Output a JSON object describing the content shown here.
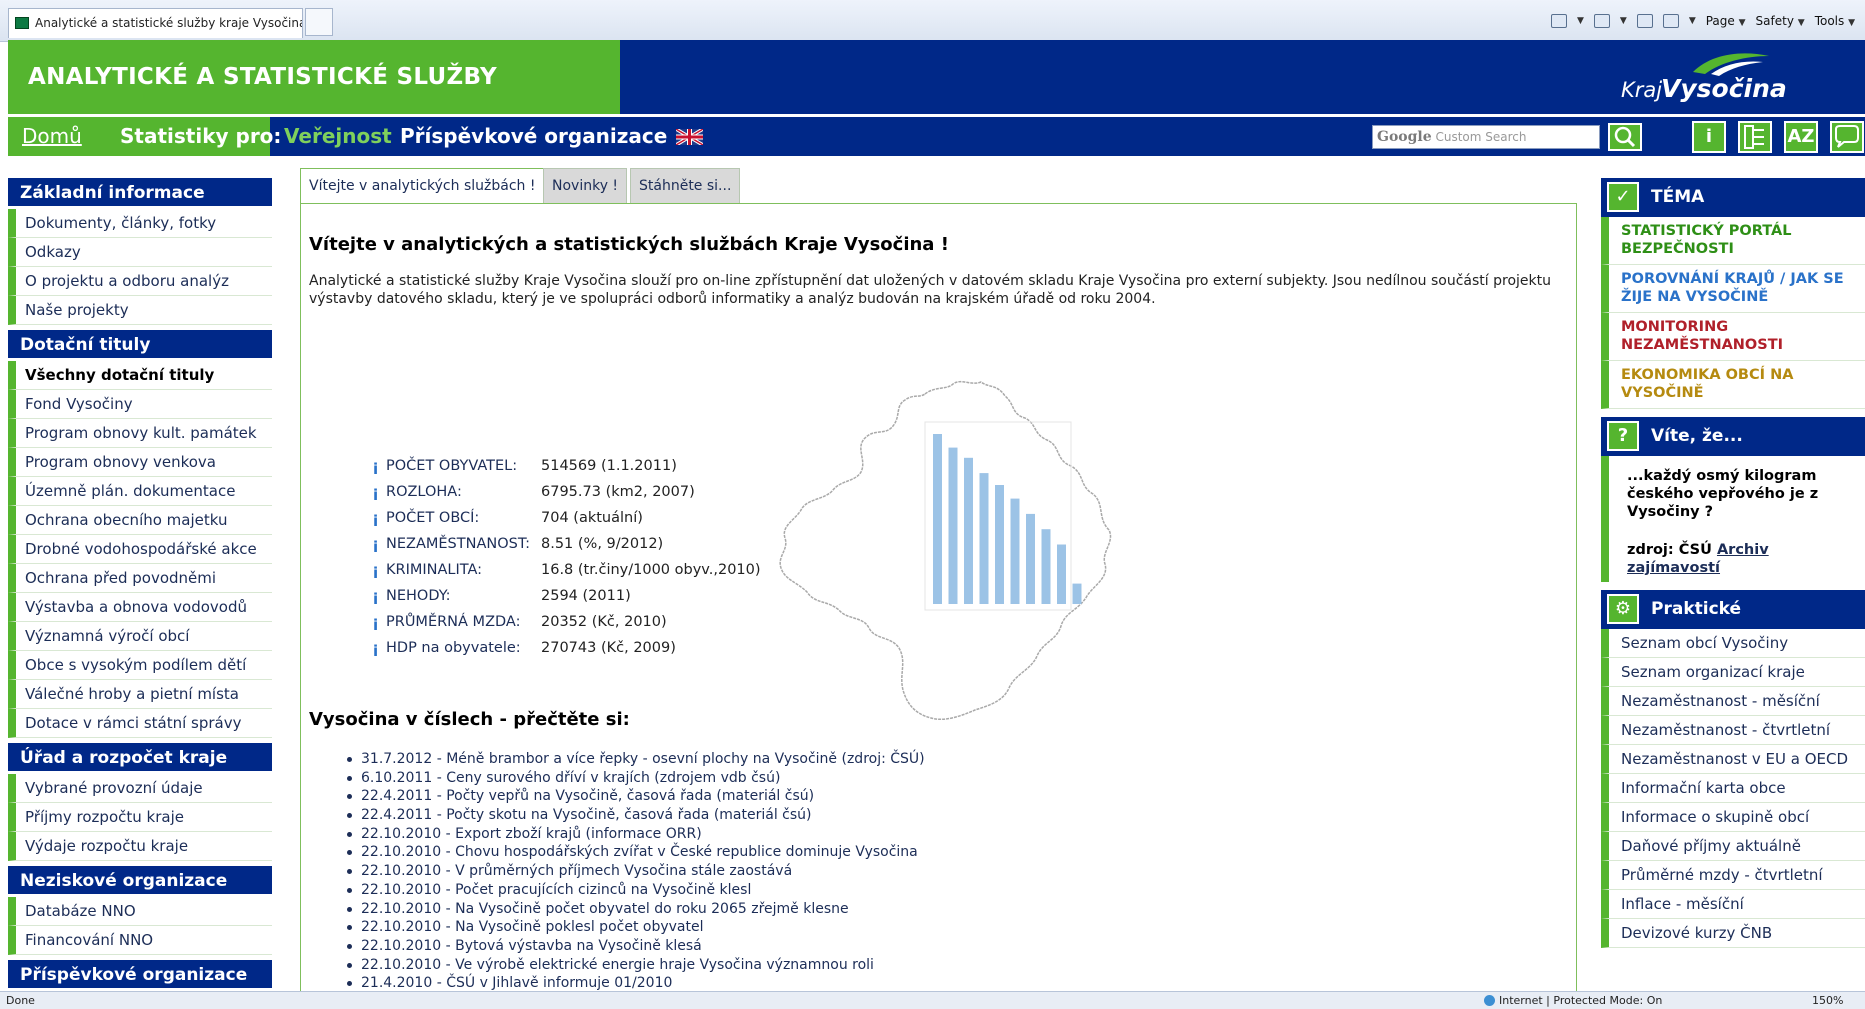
{
  "browser": {
    "tab_title": "Analytické a statistické služby kraje Vysočina",
    "commands": [
      "Page",
      "Safety",
      "Tools"
    ],
    "status_left": "Done",
    "status_zone": "Internet | Protected Mode: On",
    "status_zoom": "150%"
  },
  "header": {
    "site_title": "ANALYTICKÉ A STATISTICKÉ SLUŽBY",
    "logo_kraj": "Kraj",
    "logo_vysocina": "Vysočina",
    "brand_green": "#55b52f",
    "brand_blue": "#002888"
  },
  "nav": {
    "home": "Domů",
    "stats_for": "Statistiky pro:",
    "public": "Veřejnost",
    "contrib": "Příspěvkové organizace",
    "search_brand": "Google",
    "search_placeholder": "Custom Search",
    "tool_icons": [
      "info-icon",
      "sitemap-icon",
      "az-index-icon",
      "chat-icon"
    ],
    "tool_labels": {
      "info": "i",
      "az": "AZ"
    }
  },
  "left_sidebar": {
    "sections": [
      {
        "title": "Základní informace",
        "items": [
          "Dokumenty, články, fotky",
          "Odkazy",
          "O projektu a odboru analýz",
          "Naše projekty"
        ]
      },
      {
        "title": "Dotační tituly",
        "items": [
          "Všechny dotační tituly",
          "Fond Vysočiny",
          "Program obnovy kult. památek",
          "Program obnovy venkova",
          "Územně plán. dokumentace",
          "Ochrana obecního majetku",
          "Drobné vodohospodářské akce",
          "Ochrana před povodněmi",
          "Výstavba a obnova vodovodů",
          "Významná výročí obcí",
          "Obce s vysokým podílem dětí",
          "Válečné hroby a pietní místa",
          "Dotace v rámci státní správy"
        ]
      },
      {
        "title": "Úřad a rozpočet kraje",
        "items": [
          "Vybrané provozní údaje",
          "Příjmy rozpočtu kraje",
          "Výdaje rozpočtu kraje"
        ]
      },
      {
        "title": "Neziskové organizace",
        "items": [
          "Databáze NNO",
          "Financování NNO"
        ]
      },
      {
        "title": "Příspěvkové organizace",
        "items": []
      }
    ]
  },
  "content": {
    "tabs": [
      "Vítejte v analytických službách !",
      "Novinky !",
      "Stáhněte si..."
    ],
    "welcome_title": "Vítejte v analytických a statistických službách Kraje Vysočina !",
    "intro": "Analytické a statistické služby Kraje Vysočina slouží pro on-line zpřístupnění dat uložených v datovém skladu Kraje Vysočina pro externí subjekty. Jsou nedílnou součástí projektu výstavby datového skladu, který je ve spolupráci odborů informatiky a analýz budován na krajském úřadě od roku 2004.",
    "stats": [
      {
        "label": "POČET OBYVATEL:",
        "value": "514569  (1.1.2011)"
      },
      {
        "label": "ROZLOHA:",
        "value": "6795.73  (km2, 2007)"
      },
      {
        "label": "POČET OBCÍ:",
        "value": "704  (aktuální)"
      },
      {
        "label": "NEZAMĚSTNANOST:",
        "value": "8.51  (%, 9/2012)"
      },
      {
        "label": "KRIMINALITA:",
        "value": "16.8  (tr.činy/1000 obyv.,2010)"
      },
      {
        "label": "NEHODY:",
        "value": "2594  (2011)"
      },
      {
        "label": "PRŮMĚRNÁ MZDA:",
        "value": "20352  (Kč, 2010)"
      },
      {
        "label": "HDP na obyvatele:",
        "value": "270743  (Kč, 2009)"
      }
    ],
    "numbers_title": "Vysočina v číslech - přečtěte si:",
    "news": [
      "31.7.2012  - Méně brambor a více řepky - osevní plochy na Vysočině (zdroj: ČSÚ)",
      "6.10.2011  - Ceny surového dříví v krajích (zdrojem vdb čsú)",
      "22.4.2011  - Počty vepřů na Vysočině, časová řada (materiál čsú)",
      "22.4.2011  - Počty skotu na Vysočině, časová řada (materiál čsú)",
      "22.10.2010  - Export zboží krajů (informace ORR)",
      "22.10.2010  - Chovu hospodářských zvířat v České republice dominuje Vysočina",
      "22.10.2010  - V průměrných příjmech Vysočina stále zaostává",
      "22.10.2010  - Počet pracujících cizinců na Vysočině klesl",
      "22.10.2010  - Na Vysočině počet obyvatel do roku 2065 zřejmě klesne",
      "22.10.2010  - Na Vysočině poklesl počet obyvatel",
      "22.10.2010  - Bytová výstavba na Vysočině klesá",
      "22.10.2010  - Ve výrobě elektrické energie hraje Vysočina významnou roli",
      "21.4.2010  - ČSÚ v Jihlavě informuje 01/2010"
    ],
    "map_bars": [
      10,
      9.2,
      8.6,
      7.7,
      7.0,
      6.2,
      5.3,
      4.4,
      3.5,
      1.2
    ]
  },
  "right_sidebar": {
    "theme_title": "TÉMA",
    "themes": [
      {
        "text": "STATISTICKÝ PORTÁL BEZPEČNOSTI",
        "color": "#2e8f16"
      },
      {
        "text": "POROVNÁNÍ KRAJŮ / JAK SE ŽIJE NA VYSOČINĚ",
        "color": "#2a72c9"
      },
      {
        "text": "MONITORING NEZAMĚSTNANOSTI",
        "color": "#b0202a"
      },
      {
        "text": "EKONOMIKA OBCÍ NA VYSOČINĚ",
        "color": "#b58a10"
      }
    ],
    "fact_title": "Víte, že...",
    "fact_text": "...každý osmý kilogram českého vepřového je z Vysočiny ?",
    "fact_source": "zdroj: ČSÚ",
    "fact_link": "Archiv zajímavostí",
    "practical_title": "Praktické",
    "practical": [
      "Seznam obcí Vysočiny",
      "Seznam organizací kraje",
      "Nezaměstnanost - měsíční",
      "Nezaměstnanost - čtvrtletní",
      "Nezaměstnanost v EU a OECD",
      "Informační karta obce",
      "Informace o skupině obcí",
      "Daňové příjmy aktuálně",
      "Průměrné mzdy - čtvrtletní",
      "Inflace - měsíční",
      "Devizové kurzy ČNB"
    ]
  }
}
